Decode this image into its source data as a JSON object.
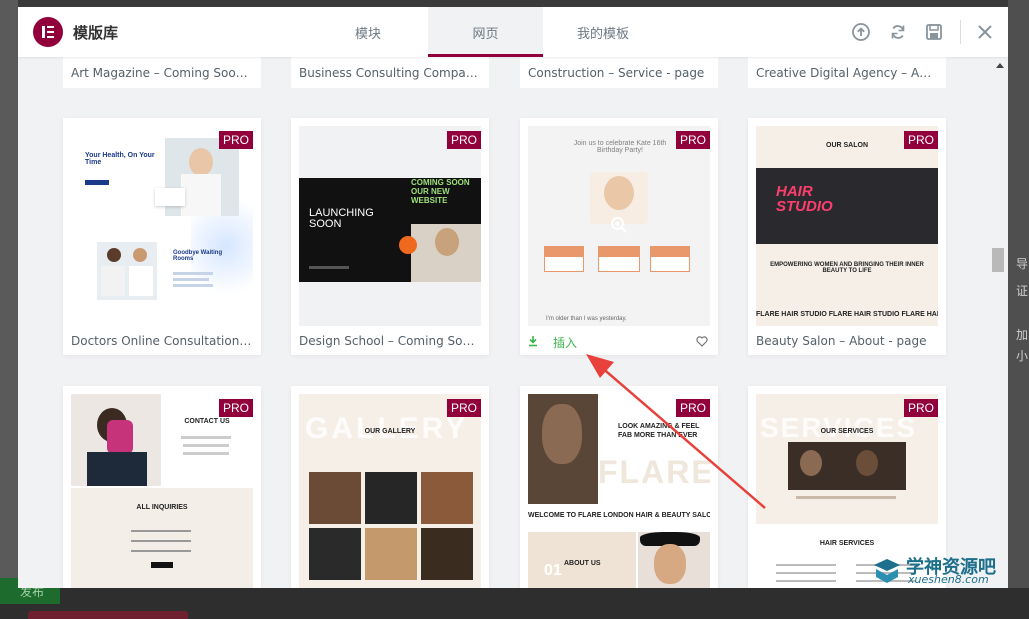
{
  "header": {
    "app_title": "模版库",
    "tabs": [
      {
        "label": "模块",
        "active": false
      },
      {
        "label": "网页",
        "active": true
      },
      {
        "label": "我的模板",
        "active": false
      }
    ],
    "icons": [
      "upload-icon",
      "sync-icon",
      "save-icon",
      "close-icon"
    ]
  },
  "badge": "PRO",
  "top_row": [
    {
      "title": "Art Magazine – Coming Soon - ..."
    },
    {
      "title": "Business Consulting Company ..."
    },
    {
      "title": "Construction – Service - page"
    },
    {
      "title": "Creative Digital Agency – About..."
    }
  ],
  "row2": [
    {
      "title": "Doctors Online Consultation -H...",
      "pro": true
    },
    {
      "title": "Design School – Coming Soon -...",
      "pro": true
    },
    {
      "title": "",
      "pro": true,
      "hover": true,
      "insert_label": "插入"
    },
    {
      "title": "Beauty Salon – About - page",
      "pro": true
    }
  ],
  "thumbs": {
    "doctors": {
      "headline": "Your Health, On Your Time",
      "sub": "Goodbye Waiting Rooms"
    },
    "design": {
      "headline": "LAUNCHING SOON",
      "marquee": "COMING SOON OUR NEW WEBSITE"
    },
    "birthday": {
      "headline": "Join us to celebrate Kate 16th Birthday Party!",
      "quote": "I'm older than I was yesterday."
    },
    "salon": {
      "top": "OUR SALON",
      "sign": "HAIR STUDIO",
      "tag": "EMPOWERING WOMEN AND BRINGING THEIR INNER BEAUTY TO LIFE",
      "ticker": "FLARE HAIR STUDIO FLARE HAIR STUDIO FLARE HAIR"
    },
    "contact": {
      "title": "CONTACT US",
      "inquiries": "ALL INQUIRIES"
    },
    "gallery": {
      "big": "GALLERY",
      "title": "OUR GALLERY"
    },
    "flare": {
      "headline": "LOOK AMAZING & FEEL FAB MORE THAN EVER",
      "big": "FLARE",
      "banner": "WELCOME TO FLARE LONDON HAIR & BEAUTY SALON",
      "about": "ABOUT US",
      "num": "01"
    },
    "services": {
      "big": "SERVICES",
      "title": "OUR SERVICES",
      "sub": "HAIR SERVICES"
    }
  },
  "background": {
    "publish": "发布",
    "right_text": [
      "导",
      "证",
      "加",
      "小"
    ]
  },
  "watermark": {
    "name": "学神资源吧",
    "url": "xueshen8.com"
  },
  "colors": {
    "brand": "#92003b",
    "insert": "#39b54a",
    "arrow": "#e8403a"
  }
}
